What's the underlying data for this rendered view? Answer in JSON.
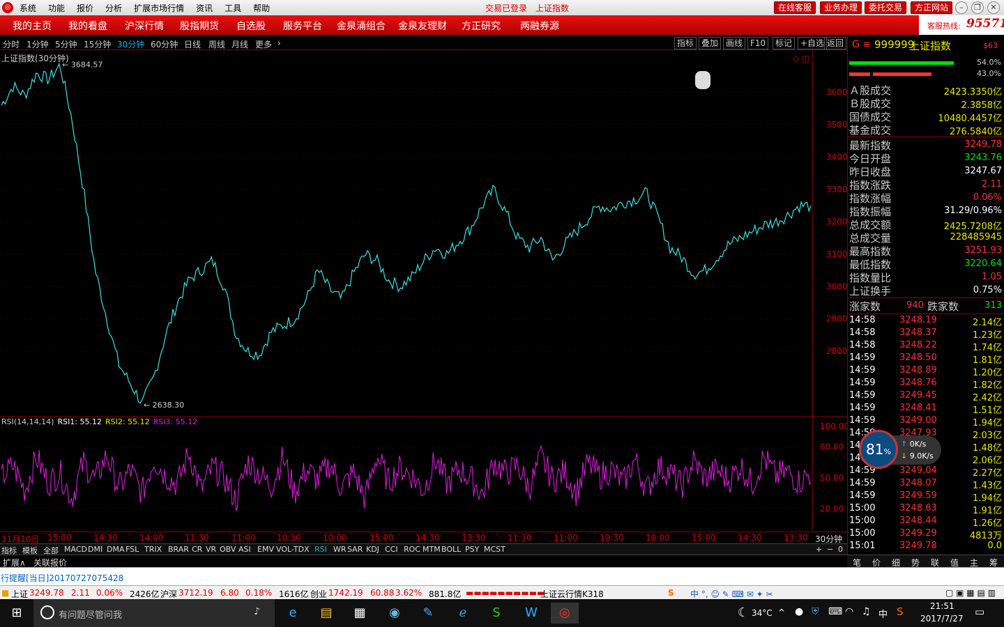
{
  "app": {
    "menu": [
      "系统",
      "功能",
      "报价",
      "分析",
      "扩展市场行情",
      "资讯",
      "工具",
      "帮助"
    ],
    "status": "交易已登录",
    "window_name": "上证指数",
    "title_buttons": [
      "在线客服",
      "业务办理",
      "委托交易",
      "方正网站"
    ]
  },
  "nav": {
    "items": [
      "我的主页",
      "我的看盘",
      "沪深行情",
      "股指期货",
      "自选股",
      "服务平台",
      "金泉涌组合",
      "金泉友理财",
      "方正研究",
      "两融券源"
    ],
    "hotline_label": "客服热线:",
    "hotline_number": "95571"
  },
  "periods": {
    "items": [
      "分时",
      "1分钟",
      "5分钟",
      "15分钟",
      "30分钟",
      "60分钟",
      "日线",
      "周线",
      "月线",
      "更多"
    ],
    "active": "30分钟",
    "tools": [
      "指标",
      "叠加",
      "画线",
      "F10",
      "标记",
      "+自选",
      "返回"
    ]
  },
  "chart_title": "上证指数(30分钟)",
  "chart_data": [
    {
      "type": "line",
      "title": "上证指数(30分钟)",
      "y_ticks": [
        3600,
        3500,
        3400,
        3300,
        3200,
        3100,
        3000,
        2900,
        2800
      ],
      "ylim": [
        2600,
        3720
      ],
      "annotations": [
        "3684.57",
        "2638.30"
      ],
      "series": [
        {
          "name": "",
          "values": [
            3560,
            3620,
            3590,
            3660,
            3640,
            3684.57,
            3520,
            3300,
            3050,
            2900,
            2760,
            2700,
            2638.3,
            2720,
            2850,
            2950,
            3020,
            3050,
            3080,
            3000,
            2850,
            2800,
            2790,
            2860,
            2880,
            2900,
            2960,
            3050,
            2990,
            2960,
            3040,
            3100,
            3080,
            3020,
            3000,
            3030,
            3080,
            3120,
            3100,
            3140,
            3180,
            3250,
            3300,
            3230,
            3150,
            3120,
            3150,
            3080,
            3130,
            3170,
            3210,
            3250,
            3240,
            3260,
            3270,
            3290,
            3210,
            3120,
            3090,
            3040,
            3050,
            3090,
            3130,
            3150,
            3170,
            3190,
            3200,
            3220,
            3250,
            3249.78
          ]
        }
      ]
    },
    {
      "type": "line",
      "title": "RSI(14,14,14)",
      "y_ticks": [
        100,
        80,
        50,
        20
      ],
      "ylim": [
        0,
        100
      ],
      "series": [
        {
          "name": "RSI3",
          "values": [
            50,
            62,
            38,
            70,
            45,
            55,
            30,
            65,
            48,
            72,
            40,
            58,
            35,
            68,
            52,
            44,
            75,
            38,
            60,
            50,
            28,
            66,
            54,
            42,
            70,
            36,
            58,
            48,
            64,
            40,
            56,
            30,
            72,
            46,
            60,
            52,
            38,
            68,
            44,
            58,
            50,
            34,
            66,
            54,
            62,
            40,
            70,
            48,
            56,
            36,
            64,
            52,
            58,
            45,
            68,
            38,
            60,
            55,
            42,
            66,
            50,
            58,
            48,
            62,
            44,
            70,
            52,
            56,
            46,
            55.12
          ]
        }
      ]
    }
  ],
  "rsi": {
    "label": "RSI(14,14,14)",
    "rsi1": "RSI1: 55.12",
    "rsi2": "RSI2: 55.12",
    "rsi3": "RSI3: 55.12"
  },
  "dates": [
    "11月10日",
    "15:00",
    "14:30",
    "14:00",
    "11:30",
    "11:00",
    "10:30",
    "10:00",
    "15:00",
    "14:30",
    "13:30",
    "11:30",
    "11:00",
    "10:30",
    "10:00",
    "15:00",
    "14:30",
    "13:30"
  ],
  "period_tag": "30分钟",
  "indicators": [
    "指标",
    "模板",
    "全部",
    "MACD",
    "DMI",
    "DMA",
    "FSL",
    "TRIX",
    "BRAR",
    "CR",
    "VR",
    "OBV",
    "ASI",
    "EMV",
    "VOL-TDX",
    "RSI",
    "WR",
    "SAR",
    "KDJ",
    "CCI",
    "ROC",
    "MTM",
    "BOLL",
    "PSY",
    "MCST"
  ],
  "active_indicator": "RSI",
  "ext": [
    "扩展∧",
    "关联报价"
  ],
  "right": {
    "code": "999999",
    "name": "上证指数",
    "tag": "$63",
    "bar1_pct": "54.0%",
    "bar2_pct": "43.0%",
    "volumes": [
      {
        "k": "Ａ股成交",
        "v": "2423.3350亿"
      },
      {
        "k": "Ｂ股成交",
        "v": "2.3858亿"
      },
      {
        "k": "国债成交",
        "v": "10480.4457亿"
      },
      {
        "k": "基金成交",
        "v": "276.5840亿"
      }
    ],
    "stats": [
      {
        "k": "最新指数",
        "v": "3249.78",
        "c": "red"
      },
      {
        "k": "今日开盘",
        "v": "3243.76",
        "c": "green"
      },
      {
        "k": "昨日收盘",
        "v": "3247.67",
        "c": "white"
      },
      {
        "k": "指数涨跌",
        "v": "2.11",
        "c": "red"
      },
      {
        "k": "指数涨幅",
        "v": "0.06%",
        "c": "red"
      },
      {
        "k": "指数振幅",
        "v": "31.29/0.96%",
        "c": "white"
      },
      {
        "k": "总成交额",
        "v": "2425.7208亿",
        "c": "yellow"
      },
      {
        "k": "总成交量",
        "v": "228485945",
        "c": "yellow"
      },
      {
        "k": "最高指数",
        "v": "3251.93",
        "c": "red"
      },
      {
        "k": "最低指数",
        "v": "3220.64",
        "c": "green"
      },
      {
        "k": "指数量比",
        "v": "1.05",
        "c": "red"
      },
      {
        "k": "上证换手",
        "v": "0.75%",
        "c": "white"
      }
    ],
    "up_label": "涨家数",
    "up": "940",
    "down_label": "跌家数",
    "down": "313",
    "ticks": [
      {
        "t": "14:58",
        "p": "3248.19",
        "v": "2.14亿"
      },
      {
        "t": "14:58",
        "p": "3248.37",
        "v": "1.23亿"
      },
      {
        "t": "14:58",
        "p": "3248.22",
        "v": "1.74亿"
      },
      {
        "t": "14:59",
        "p": "3248.50",
        "v": "1.81亿"
      },
      {
        "t": "14:59",
        "p": "3248.89",
        "v": "1.20亿"
      },
      {
        "t": "14:59",
        "p": "3248.76",
        "v": "1.82亿"
      },
      {
        "t": "14:59",
        "p": "3249.45",
        "v": "2.42亿"
      },
      {
        "t": "14:59",
        "p": "3248.41",
        "v": "1.51亿"
      },
      {
        "t": "14:59",
        "p": "3249.00",
        "v": "1.94亿"
      },
      {
        "t": "14:59",
        "p": "3247.93",
        "v": "2.03亿"
      },
      {
        "t": "14:59",
        "p": "3248.27",
        "v": "1.48亿"
      },
      {
        "t": "14:59",
        "p": "3248.79",
        "v": "2.06亿"
      },
      {
        "t": "14:59",
        "p": "3249.04",
        "v": "2.27亿"
      },
      {
        "t": "14:59",
        "p": "3248.07",
        "v": "1.43亿"
      },
      {
        "t": "14:59",
        "p": "3249.59",
        "v": "1.94亿"
      },
      {
        "t": "15:00",
        "p": "3248.63",
        "v": "1.91亿"
      },
      {
        "t": "15:00",
        "p": "3248.44",
        "v": "1.26亿"
      },
      {
        "t": "15:00",
        "p": "3249.29",
        "v": "4813万"
      },
      {
        "t": "15:01",
        "p": "3249.78",
        "v": "0.0"
      }
    ],
    "tabs": [
      "笔",
      "价",
      "细",
      "势",
      "联",
      "值",
      "主",
      "筹"
    ]
  },
  "alert": "行提醒[当日]20170727075428",
  "status": [
    {
      "label": "上证",
      "price": "3249.78",
      "chg": "2.11",
      "pct": "0.06%",
      "amt": "2426亿"
    },
    {
      "label": "沪深",
      "price": "3712.19",
      "chg": "6.80",
      "pct": "0.18%",
      "amt": "1616亿"
    },
    {
      "label": "创业",
      "price": "1742.19",
      "chg": "60.88",
      "pct": "3.62%",
      "amt": "881.8亿"
    }
  ],
  "cloud": "上证云行情K318",
  "net": {
    "pct": "81",
    "unit": "%",
    "up": "0K/s",
    "down": "9.0K/s"
  },
  "taskbar": {
    "search_placeholder": "有问题尽管问我",
    "temp": "34°C",
    "ime": "中",
    "time": "21:51",
    "date": "2017/7/27"
  },
  "colors": {
    "accent": "#d40000",
    "up": "#ff3030",
    "down": "#00e000",
    "rsi3": "#e020e0",
    "cyan": "#40e0e0"
  }
}
